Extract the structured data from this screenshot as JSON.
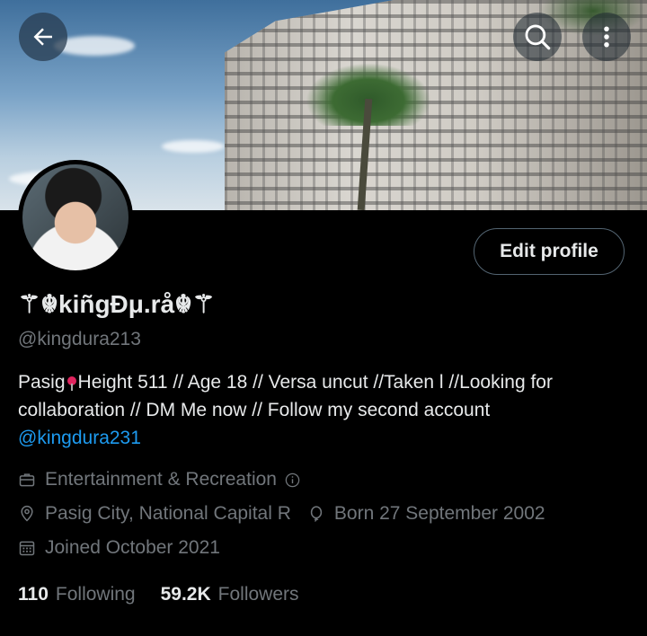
{
  "header": {
    "back_icon": "arrow-left-icon",
    "search_icon": "search-icon",
    "more_icon": "more-vertical-icon"
  },
  "profile": {
    "display_name": "⚚☬kiñgĐμ.rå☬⚚",
    "handle": "@kingdura213",
    "edit_button_label": "Edit profile",
    "bio_part1": "Pasig",
    "bio_part2": "Height 511 // Age 18 // Versa uncut //Taken l //Looking for collaboration // DM Me now // Follow my second account",
    "bio_link": "@kingdura231",
    "category": "Entertainment & Recreation",
    "location": "Pasig City, National Capital R",
    "birthday": "Born 27 September 2002",
    "joined": "Joined October 2021",
    "following_count": "110",
    "following_label": "Following",
    "followers_count": "59.2K",
    "followers_label": "Followers"
  },
  "colors": {
    "background": "#000000",
    "text_primary": "#e7e9ea",
    "text_secondary": "#71767b",
    "link": "#1d9bf0",
    "button_border": "#536471"
  }
}
